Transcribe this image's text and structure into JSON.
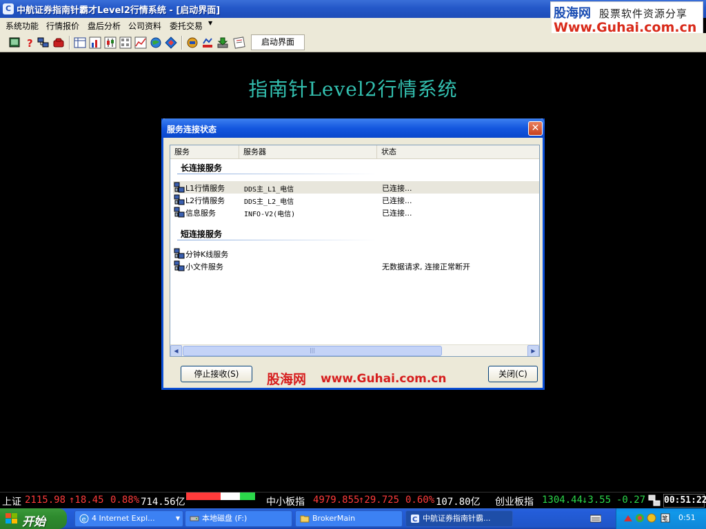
{
  "window": {
    "title": "中航证券指南针霸才Level2行情系统 - [启动界面]",
    "icon_glyph": "C"
  },
  "watermark": {
    "brand": "股海网",
    "slogan": "股票软件资源分享",
    "url": "Www.Guhai.com.cn"
  },
  "menu": {
    "items": [
      "系统功能",
      "行情报价",
      "盘后分析",
      "公司资料",
      "委托交易"
    ]
  },
  "toolbar": {
    "active_tab": "启动界面"
  },
  "main": {
    "heading": "指南针Level2行情系统"
  },
  "dialog": {
    "title": "服务连接状态",
    "columns": [
      "服务",
      "服务器",
      "状态"
    ],
    "group_long": "长连接服务",
    "group_short": "短连接服务",
    "long_rows": [
      {
        "name": "L1行情服务",
        "server": "DDS主_L1_电信",
        "state": "已连接..."
      },
      {
        "name": "L2行情服务",
        "server": "DDS主_L2_电信",
        "state": "已连接..."
      },
      {
        "name": "信息服务",
        "server": "INFO-V2(电信)",
        "state": "已连接..."
      }
    ],
    "short_rows": [
      {
        "name": "分钟K线服务",
        "server": "",
        "state": ""
      },
      {
        "name": "小文件服务",
        "server": "",
        "state": "无数据请求, 连接正常断开"
      }
    ],
    "stop_button": "停止接收(S)",
    "close_button": "关闭(C)",
    "watermark_brand": "股海网",
    "watermark_url": "www.Guhai.com.cn"
  },
  "ticker": {
    "sh_label": "上证",
    "sh_value": "2115.98",
    "sh_change": "↑18.45",
    "sh_pct": "0.88%",
    "sh_amount": "714.56亿",
    "sme_label": "中小板指",
    "sme_value": "4979.855",
    "sme_change": "↑29.725",
    "sme_pct": "0.60%",
    "sme_amount": "107.80亿",
    "gem_label": "创业板指",
    "gem_value": "1304.44",
    "gem_change": "↓3.55",
    "gem_pct": "-0.27",
    "clock": "00:51:22",
    "colors": {
      "up": "#ff3b3b",
      "down": "#2bd84a"
    }
  },
  "taskbar": {
    "start_label": "开始",
    "tasks": [
      {
        "label": "4 Internet Expl...",
        "icon": "ie-icon"
      },
      {
        "label": "本地磁盘 (F:)",
        "icon": "drive-icon"
      },
      {
        "label": "BrokerMain",
        "icon": "folder-icon"
      },
      {
        "label": "中航证券指南针霸...",
        "icon": "app-icon"
      }
    ],
    "clock": "0:51"
  }
}
